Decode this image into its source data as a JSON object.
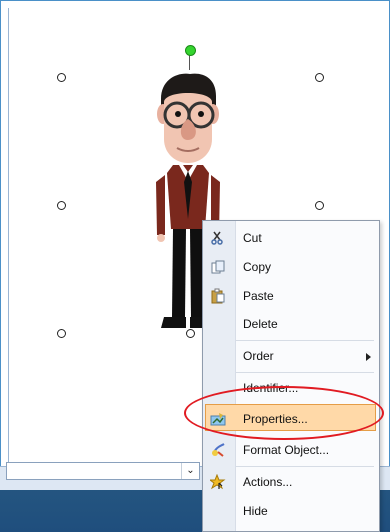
{
  "context_menu": {
    "items": [
      {
        "label": "Cut",
        "icon": "cut-icon"
      },
      {
        "label": "Copy",
        "icon": "copy-icon"
      },
      {
        "label": "Paste",
        "icon": "paste-icon"
      },
      {
        "label": "Delete",
        "icon": ""
      },
      {
        "label": "Order",
        "icon": ""
      },
      {
        "label": "Identifier...",
        "icon": ""
      },
      {
        "label": "Properties...",
        "icon": "properties-icon"
      },
      {
        "label": "Format Object...",
        "icon": "format-object-icon"
      },
      {
        "label": "Actions...",
        "icon": "actions-icon"
      },
      {
        "label": "Hide",
        "icon": ""
      }
    ],
    "highlighted_item": "Properties...",
    "annotation_color": "#e11b22"
  },
  "bottom_bar": {
    "dropdown_value": "",
    "dropdown_arrow": "⌄"
  }
}
